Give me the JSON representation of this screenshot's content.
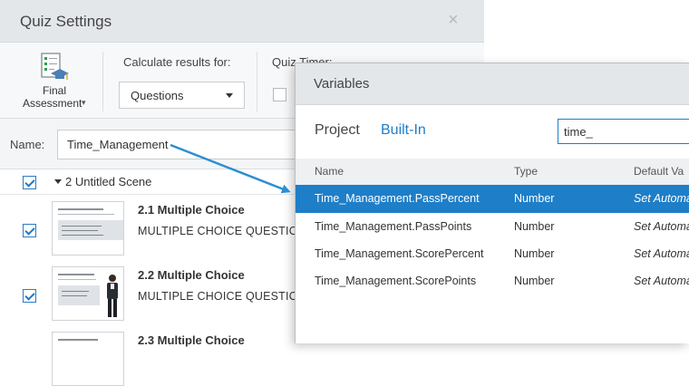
{
  "quiz_settings": {
    "title": "Quiz Settings",
    "close_glyph": "×",
    "toolbar": {
      "final_assessment_line1": "Final",
      "final_assessment_line2": "Assessment",
      "final_caret": "▾",
      "calculate_label": "Calculate results for:",
      "calculate_value": "Questions",
      "timer_label": "Quiz Timer:"
    },
    "name_label": "Name:",
    "name_value": "Time_Management",
    "scene": {
      "label": "2 Untitled Scene",
      "checked": true
    },
    "slides": [
      {
        "title": "2.1 Multiple Choice",
        "subtitle": "MULTIPLE CHOICE QUESTION",
        "checked": true
      },
      {
        "title": "2.2 Multiple Choice",
        "subtitle": "MULTIPLE CHOICE QUESTION",
        "checked": true
      },
      {
        "title": "2.3 Multiple Choice",
        "subtitle": "",
        "checked": false
      }
    ]
  },
  "variables": {
    "title": "Variables",
    "tabs": {
      "project": "Project",
      "builtin": "Built-In"
    },
    "search_value": "time_",
    "columns": {
      "name": "Name",
      "type": "Type",
      "default": "Default Va"
    },
    "rows": [
      {
        "name": "Time_Management.PassPercent",
        "type": "Number",
        "default": "Set Automa",
        "selected": true
      },
      {
        "name": "Time_Management.PassPoints",
        "type": "Number",
        "default": "Set Automa",
        "selected": false
      },
      {
        "name": "Time_Management.ScorePercent",
        "type": "Number",
        "default": "Set Automa",
        "selected": false
      },
      {
        "name": "Time_Management.ScorePoints",
        "type": "Number",
        "default": "Set Automa",
        "selected": false
      }
    ]
  },
  "colors": {
    "accent": "#1e7ec8",
    "arrow": "#2b8fd0"
  }
}
